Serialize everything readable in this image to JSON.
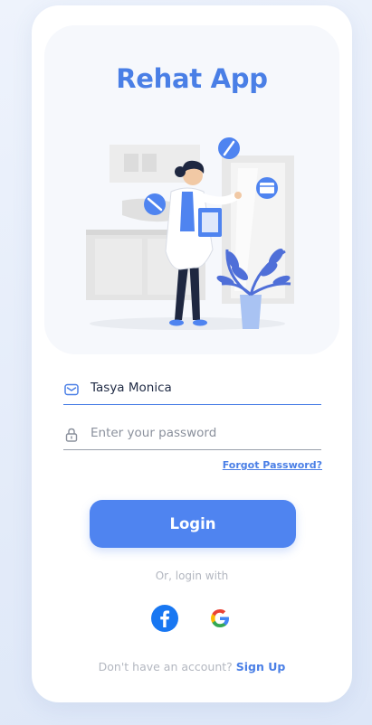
{
  "app": {
    "title": "Rehat App"
  },
  "illustration": {
    "subject": "doctor holding clipboard beside potted plant"
  },
  "form": {
    "email": {
      "icon": "mail-icon",
      "value": "Tasya Monica"
    },
    "password": {
      "icon": "lock-icon",
      "placeholder": "Enter your password",
      "value": ""
    },
    "forgot_label": "Forgot Password?"
  },
  "login_button": {
    "label": "Login"
  },
  "alternate_login": {
    "label": "Or, login with",
    "providers": [
      {
        "name": "facebook",
        "icon": "facebook-icon"
      },
      {
        "name": "google",
        "icon": "google-icon"
      }
    ]
  },
  "signup": {
    "prompt": "Don't have an account?",
    "link_label": "Sign Up"
  },
  "colors": {
    "accent": "#4a7fe6",
    "button": "#4f84f0",
    "muted": "#b3b7c0",
    "text": "#1f2a44",
    "card": "#f6f8fc",
    "facebook": "#1877f2"
  }
}
